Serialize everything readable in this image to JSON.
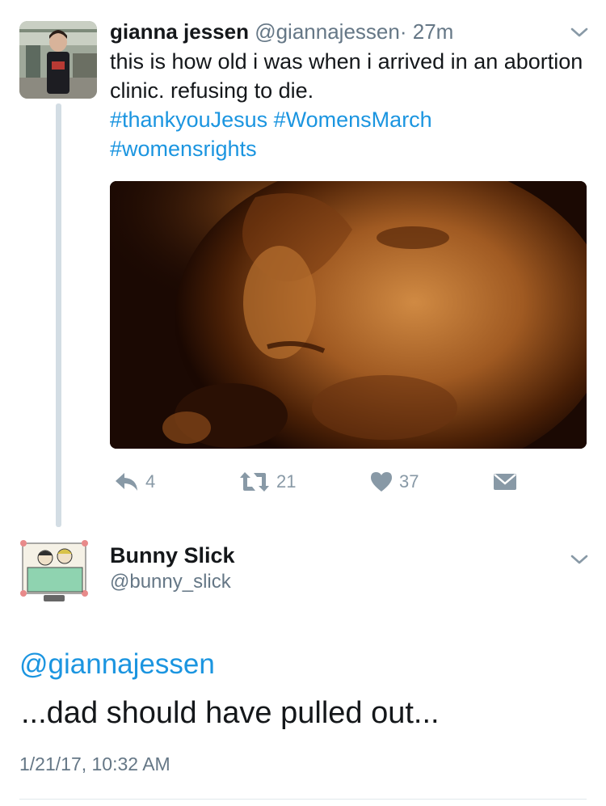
{
  "tweet": {
    "author_name": "gianna jessen",
    "author_handle": "@giannajessen",
    "separator": "·",
    "time": "27m",
    "text": "this is how old i was when i arrived in an abortion clinic. refusing to die.",
    "hashtags_line1": "#thankyouJesus #WomensMarch",
    "hashtags_line2": "#womensrights",
    "actions": {
      "reply_count": "4",
      "retweet_count": "21",
      "like_count": "37"
    },
    "icons": [
      "chevron-down-icon",
      "reply-icon",
      "retweet-icon",
      "heart-icon",
      "dm-icon"
    ]
  },
  "reply": {
    "author_name": "Bunny Slick",
    "author_handle": "@bunny_slick",
    "mention": "@giannajessen",
    "text": "...dad should have pulled out...",
    "timestamp": "1/21/17, 10:32 AM"
  },
  "colors": {
    "link": "#1b95e0",
    "secondary_text": "#657786",
    "action_icon": "#8899a6",
    "thread_line": "#d3dde4"
  }
}
